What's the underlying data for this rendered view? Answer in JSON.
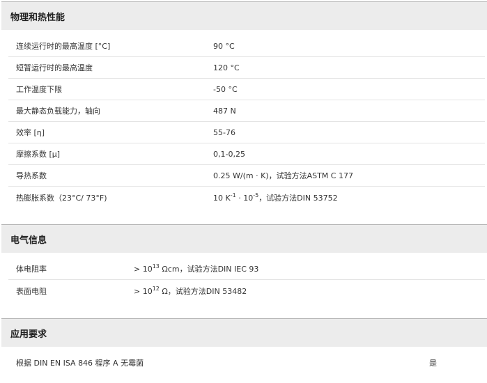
{
  "sections": [
    {
      "title": "物理和热性能",
      "rows": [
        {
          "label": "连续运行时的最高温度 [°C]",
          "value": "90 °C"
        },
        {
          "label": "短暂运行时的最高温度",
          "value": "120 °C"
        },
        {
          "label": "工作温度下限",
          "value": "-50 °C"
        },
        {
          "label": "最大静态负载能力，轴向",
          "value": "487 N"
        },
        {
          "label": "效率 [η]",
          "value": "55-76"
        },
        {
          "label": "摩擦系数 [μ]",
          "value": "0,1-0,25"
        },
        {
          "label": "导热系数",
          "value": "0.25 W/(m · K)，试验方法ASTM C 177"
        },
        {
          "label": "热膨胀系数（23°C/ 73°F)",
          "value_parts": {
            "a": "10 K",
            "sup1": "-1",
            "b": " · 10",
            "sup2": "-5",
            "c": "，试验方法DIN 53752"
          }
        }
      ]
    },
    {
      "title": "电气信息",
      "rows": [
        {
          "label": "体电阻率",
          "value_parts": {
            "a": "> 10",
            "sup": "13",
            "b": " Ωcm，试验方法DIN IEC 93"
          }
        },
        {
          "label": "表面电阻",
          "value_parts": {
            "a": "> 10",
            "sup": "12",
            "b": " Ω，试验方法DIN 53482"
          }
        }
      ]
    },
    {
      "title": "应用要求",
      "rows": [
        {
          "label": "根据 DIN EN ISA 846 程序 A 无霉菌",
          "value": "是"
        }
      ]
    }
  ],
  "colors": {
    "header_bg": "#ececec",
    "header_border": "#b5b5b5",
    "row_divider": "#e4e4e4",
    "text": "#333333"
  }
}
